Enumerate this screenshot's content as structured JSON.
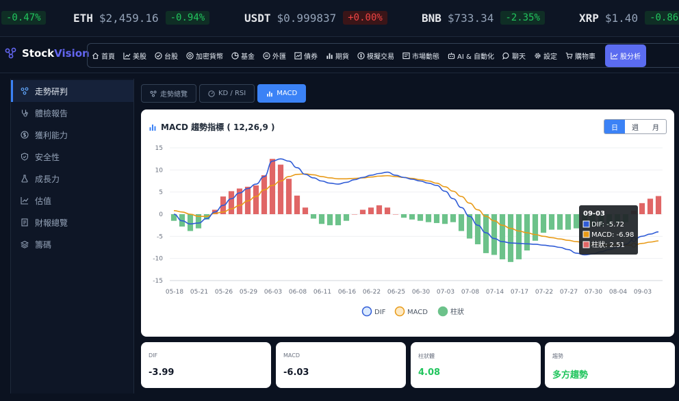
{
  "ticker": [
    {
      "symbol": "",
      "price": "",
      "change": "-0.47%",
      "dir": "neg"
    },
    {
      "symbol": "ETH",
      "price": "$2,459.16",
      "change": "-0.94%",
      "dir": "neg"
    },
    {
      "symbol": "USDT",
      "price": "$0.999837",
      "change": "+0.00%",
      "dir": "pos"
    },
    {
      "symbol": "BNB",
      "price": "$733.34",
      "change": "-2.35%",
      "dir": "neg"
    },
    {
      "symbol": "XRP",
      "price": "$1.40",
      "change": "-0.86",
      "dir": "neg"
    }
  ],
  "brand": {
    "name_a": "Stock",
    "name_b": "Vision"
  },
  "nav": [
    {
      "label": "首頁",
      "icon": "home-icon"
    },
    {
      "label": "美股",
      "icon": "chart-line-icon"
    },
    {
      "label": "台股",
      "icon": "check-circle-icon"
    },
    {
      "label": "加密貨幣",
      "icon": "coin-icon"
    },
    {
      "label": "基金",
      "icon": "pie-icon"
    },
    {
      "label": "外匯",
      "icon": "exchange-icon"
    },
    {
      "label": "債券",
      "icon": "trend-icon"
    },
    {
      "label": "期貨",
      "icon": "bars-icon"
    },
    {
      "label": "模擬交易",
      "icon": "gear-coin-icon"
    },
    {
      "label": "市場動態",
      "icon": "news-icon"
    },
    {
      "label": "AI & 自動化",
      "icon": "robot-icon"
    },
    {
      "label": "聊天",
      "icon": "chat-icon"
    },
    {
      "label": "設定",
      "icon": "gear-icon"
    },
    {
      "label": "購物車",
      "icon": "cart-icon"
    },
    {
      "label": "股分析",
      "icon": "analysis-icon"
    }
  ],
  "sidebar": [
    {
      "label": "走勢研判",
      "icon": "trend-nodes-icon"
    },
    {
      "label": "體檢報告",
      "icon": "stethoscope-icon"
    },
    {
      "label": "獲利能力",
      "icon": "dollar-circle-icon"
    },
    {
      "label": "安全性",
      "icon": "shield-icon"
    },
    {
      "label": "成長力",
      "icon": "flask-icon"
    },
    {
      "label": "估值",
      "icon": "chart-line-icon"
    },
    {
      "label": "財報總覽",
      "icon": "report-icon"
    },
    {
      "label": "籌碼",
      "icon": "layers-icon"
    }
  ],
  "tabs": [
    {
      "label": "走勢總覽",
      "icon": "trend-nodes-icon"
    },
    {
      "label": "KD / RSI",
      "icon": "gauge-icon"
    },
    {
      "label": "MACD",
      "icon": "bars-icon"
    }
  ],
  "card": {
    "title": "MACD 趨勢指標 ( 12,26,9 )"
  },
  "periods": [
    "日",
    "週",
    "月"
  ],
  "tooltip": {
    "date": "09-03",
    "dif": "DIF: -5.72",
    "macd": "MACD: -6.98",
    "hist": "柱狀: 2.51"
  },
  "legend": {
    "dif": "DIF",
    "macd": "MACD",
    "hist": "柱狀"
  },
  "stats": [
    {
      "label": "DIF",
      "value": "-3.99"
    },
    {
      "label": "MACD",
      "value": "-6.03"
    },
    {
      "label": "柱狀體",
      "value": "4.08"
    },
    {
      "label": "趨勢",
      "value": "多方趨勢"
    }
  ],
  "colors": {
    "accent": "#3b82f6",
    "dif": "#2f5bd6",
    "macd": "#e89a17",
    "hist_pos": "#e06666",
    "hist_neg": "#6cc28a"
  },
  "chart_data": {
    "type": "bar",
    "x_labels": [
      "05-18",
      "05-21",
      "05-26",
      "05-29",
      "06-03",
      "06-08",
      "06-11",
      "06-16",
      "06-22",
      "06-25",
      "06-30",
      "07-03",
      "07-08",
      "07-14",
      "07-17",
      "07-22",
      "07-27",
      "07-30",
      "08-04",
      "09-03"
    ],
    "ylim": [
      -15,
      15
    ],
    "yticks": [
      15,
      10,
      5,
      0,
      -5,
      -10,
      -15
    ],
    "histogram": [
      -1.5,
      -2.8,
      -3.8,
      -3.2,
      -1.2,
      1.0,
      4.0,
      5.2,
      5.8,
      6.2,
      6.5,
      8.8,
      12.5,
      11.2,
      8.0,
      4.2,
      1.5,
      -1.0,
      -2.2,
      -2.5,
      -2.5,
      -1.5,
      0.0,
      1.0,
      1.5,
      2.0,
      1.5,
      0.0,
      -0.8,
      -1.2,
      -1.5,
      -1.8,
      -2.0,
      -2.2,
      -1.8,
      -3.8,
      -5.5,
      -6.8,
      -8.8,
      -9.2,
      -10.2,
      -10.8,
      -10.2,
      -8.2,
      -6.0,
      -4.2,
      -3.5,
      -3.5,
      -3.5,
      -3.2,
      -3.2,
      -2.8,
      -2.8,
      -2.6,
      -2.0,
      -1.8,
      0.8,
      2.5,
      3.5,
      4.1
    ],
    "series": [
      {
        "name": "DIF",
        "values": [
          0.0,
          -1.5,
          -2.2,
          -2.0,
          -1.0,
          0.5,
          2.0,
          3.5,
          4.8,
          5.8,
          6.8,
          8.5,
          12.0,
          12.5,
          12.0,
          10.5,
          9.0,
          8.2,
          7.5,
          7.0,
          6.8,
          7.2,
          7.8,
          8.3,
          8.8,
          9.2,
          9.5,
          8.8,
          8.3,
          7.9,
          7.5,
          7.0,
          6.5,
          5.2,
          3.5,
          1.5,
          -0.5,
          -2.5,
          -4.2,
          -5.5,
          -6.2,
          -6.5,
          -6.6,
          -6.7,
          -6.8,
          -7.0,
          -7.2,
          -7.5,
          -8.0,
          -8.8,
          -9.2,
          -9.0,
          -8.5,
          -8.0,
          -7.5,
          -6.8,
          -5.7,
          -5.0,
          -4.5,
          -3.99
        ]
      },
      {
        "name": "MACD",
        "values": [
          0.8,
          0.5,
          0.0,
          -0.5,
          -0.5,
          0.2,
          0.5,
          1.2,
          2.0,
          3.0,
          4.0,
          5.5,
          6.5,
          7.5,
          8.5,
          9.0,
          9.1,
          8.9,
          8.5,
          8.2,
          8.0,
          8.0,
          8.1,
          8.2,
          8.4,
          8.6,
          8.7,
          8.5,
          8.3,
          8.1,
          7.8,
          7.5,
          7.0,
          6.2,
          5.2,
          4.0,
          2.5,
          1.0,
          -0.5,
          -1.5,
          -2.5,
          -3.2,
          -3.8,
          -4.2,
          -4.6,
          -5.0,
          -5.3,
          -5.6,
          -5.9,
          -6.2,
          -6.5,
          -6.8,
          -7.0,
          -7.0,
          -7.0,
          -7.0,
          -6.98,
          -6.6,
          -6.3,
          -6.03
        ]
      }
    ],
    "legend": [
      "DIF",
      "MACD",
      "柱狀"
    ]
  }
}
